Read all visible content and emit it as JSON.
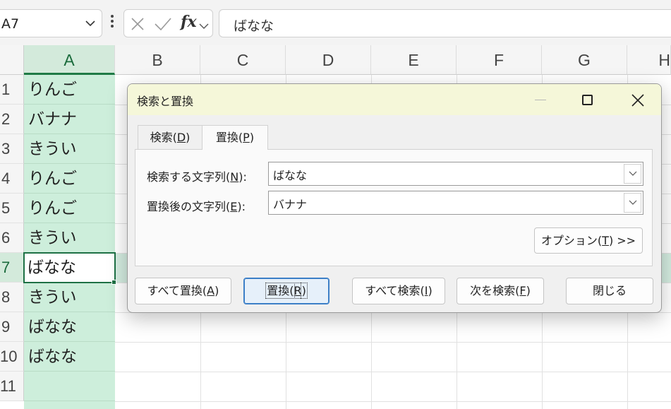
{
  "formula_bar": {
    "name_box": "A7",
    "fx_label": "fx",
    "formula_value": "ばなな"
  },
  "grid": {
    "columns": [
      "A",
      "B",
      "C",
      "D",
      "E",
      "F",
      "G",
      "H"
    ],
    "rows": [
      "1",
      "2",
      "3",
      "4",
      "5",
      "6",
      "7",
      "8",
      "9",
      "10",
      "11"
    ],
    "column_a_values": [
      "りんご",
      "バナナ",
      "きうい",
      "りんご",
      "りんご",
      "きうい",
      "ばなな",
      "きうい",
      "ばなな",
      "ばなな",
      ""
    ],
    "active_cell": "A7",
    "selection_color": "#cdeedb",
    "active_border_color": "#1e7145"
  },
  "dialog": {
    "title": "検索と置換",
    "tabs": [
      {
        "label": "検索(",
        "key": "D",
        "suffix": ")"
      },
      {
        "label": "置換(",
        "key": "P",
        "suffix": ")"
      }
    ],
    "find_label": {
      "text": "検索する文字列(",
      "key": "N",
      "suffix": "):"
    },
    "find_value": "ばなな",
    "replace_label": {
      "text": "置換後の文字列(",
      "key": "E",
      "suffix": "):"
    },
    "replace_value": "バナナ",
    "options_button": {
      "text": "オプション(",
      "key": "T",
      "suffix": ") >>"
    },
    "buttons": {
      "replace_all": {
        "text": "すべて置換(",
        "key": "A",
        "suffix": ")"
      },
      "replace": {
        "text": "置換(",
        "key": "R",
        "suffix": ")"
      },
      "find_all": {
        "text": "すべて検索(",
        "key": "I",
        "suffix": ")"
      },
      "find_next": {
        "text": "次を検索(",
        "key": "F",
        "suffix": ")"
      },
      "close": "閉じる"
    },
    "titlebar_color": "#f5f7d9"
  }
}
